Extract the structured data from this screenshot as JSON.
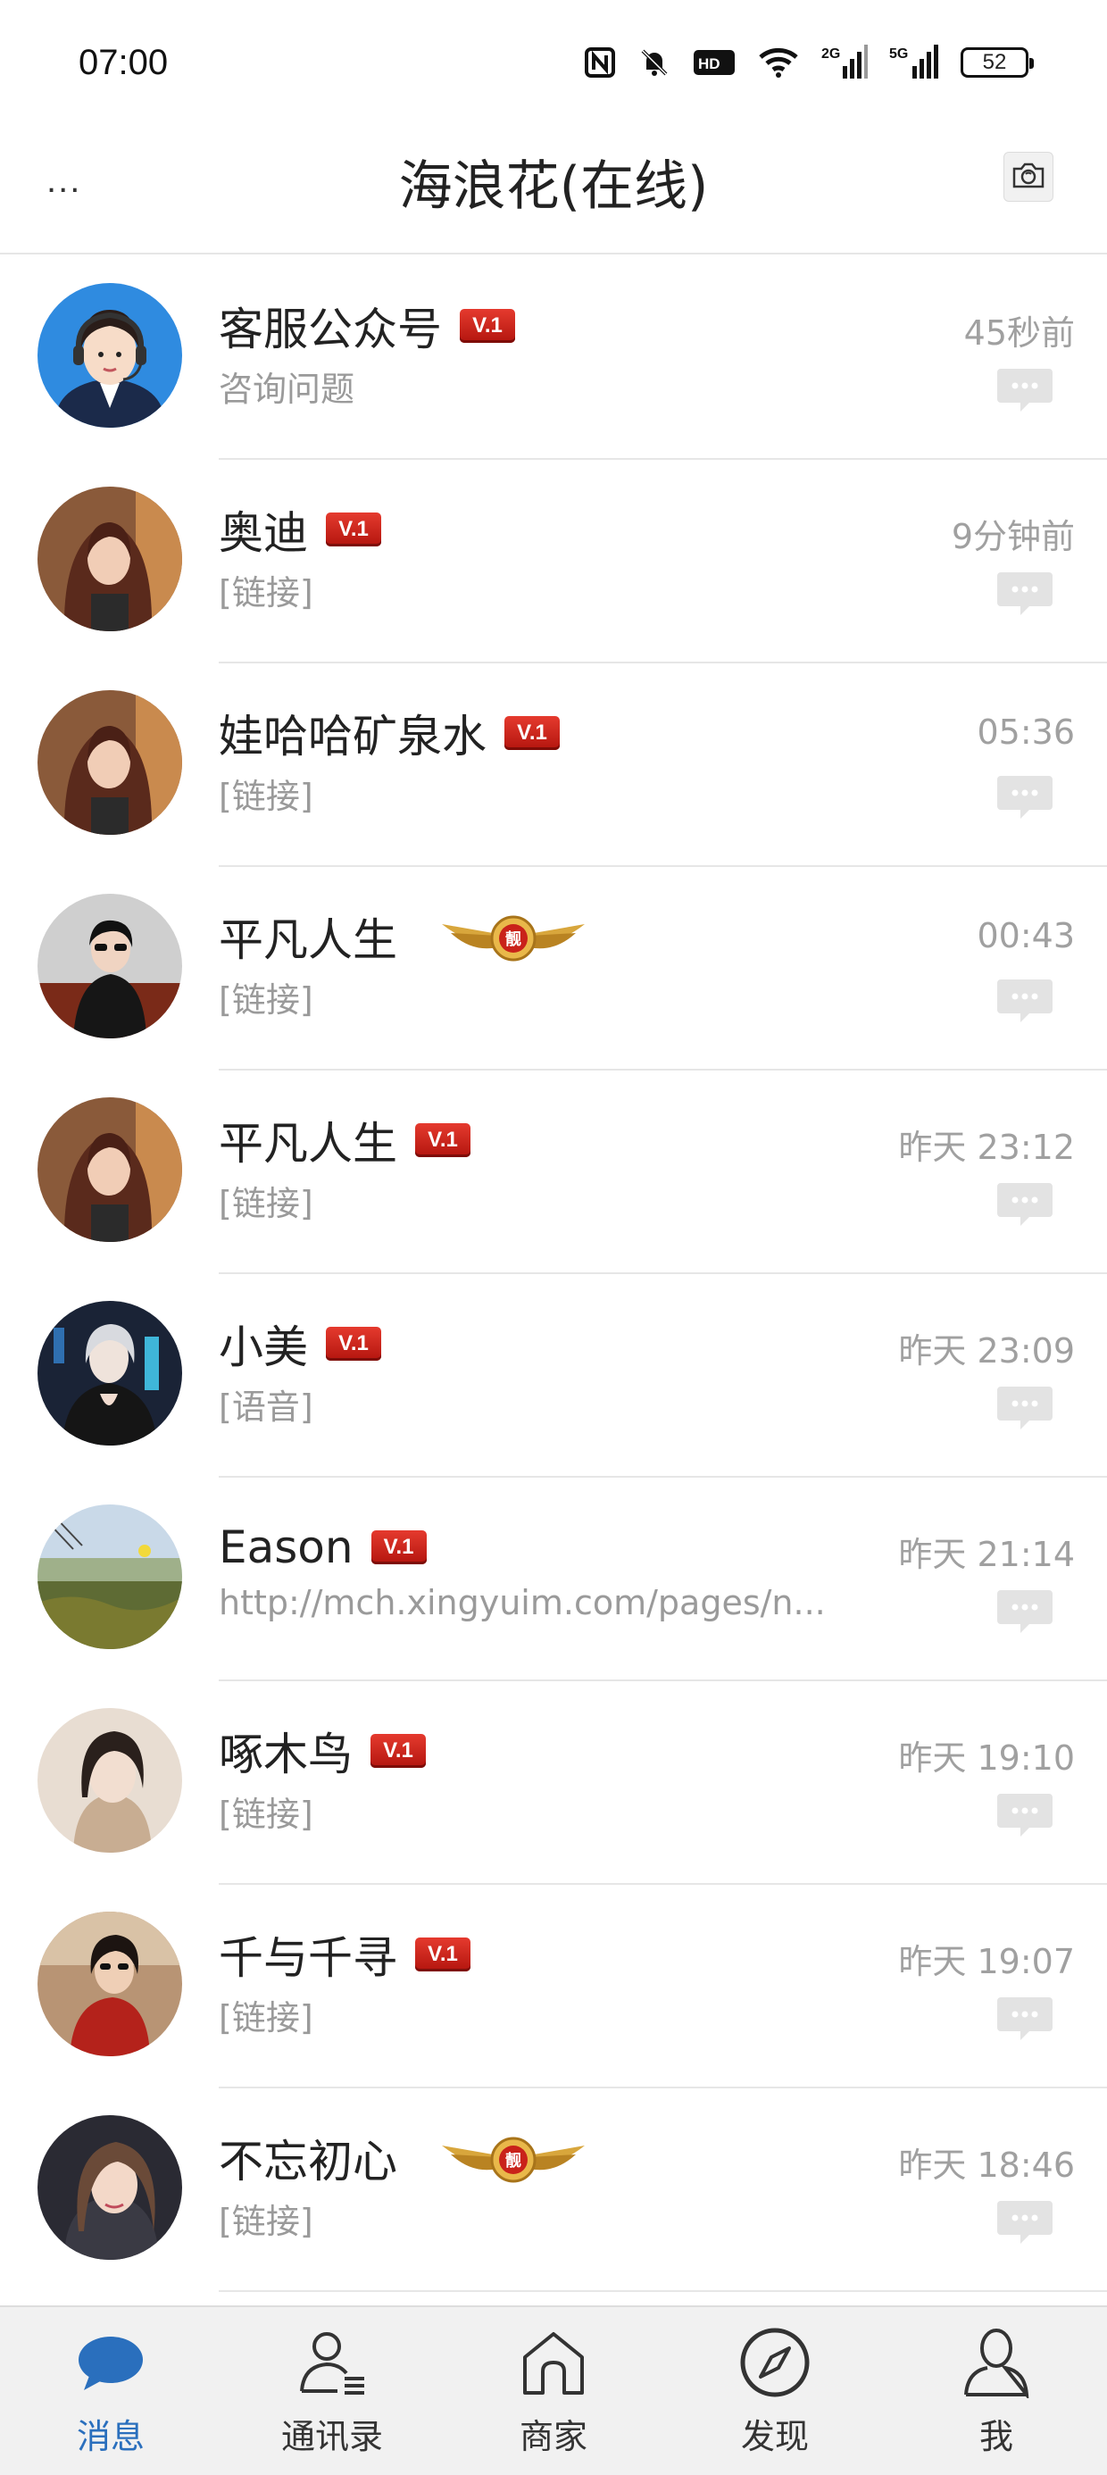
{
  "status_bar": {
    "time": "07:00",
    "battery": "52",
    "net_2g": "2G",
    "net_5g": "5G",
    "hd_label": "HD",
    "icons": [
      "nfc-icon",
      "mute-bell-icon",
      "hd-icon",
      "wifi-icon",
      "signal-2g-icon",
      "signal-5g-icon",
      "battery-icon"
    ]
  },
  "header": {
    "more_label": "...",
    "title": "海浪花(在线)",
    "camera_icon": "camera-icon"
  },
  "badges": {
    "v1": "V.1",
    "crown": "靓"
  },
  "chats": [
    {
      "name": "客服公众号",
      "badge": "v1",
      "preview": "咨询问题",
      "time": "45秒前"
    },
    {
      "name": "奥迪",
      "badge": "v1",
      "preview": "[链接]",
      "time": "9分钟前"
    },
    {
      "name": "娃哈哈矿泉水",
      "badge": "v1",
      "preview": "[链接]",
      "time": "05:36"
    },
    {
      "name": "平凡人生",
      "badge": "crown",
      "preview": "[链接]",
      "time": "00:43"
    },
    {
      "name": "平凡人生",
      "badge": "v1",
      "preview": "[链接]",
      "time": "昨天 23:12"
    },
    {
      "name": "小美",
      "badge": "v1",
      "preview": "[语音]",
      "time": "昨天 23:09"
    },
    {
      "name": "Eason",
      "badge": "v1",
      "preview": "http://mch.xingyuim.com/pages/n...",
      "time": "昨天 21:14"
    },
    {
      "name": "啄木鸟",
      "badge": "v1",
      "preview": "[链接]",
      "time": "昨天 19:10"
    },
    {
      "name": "千与千寻",
      "badge": "v1",
      "preview": "[链接]",
      "time": "昨天 19:07"
    },
    {
      "name": "不忘初心",
      "badge": "crown",
      "preview": "[链接]",
      "time": "昨天 18:46"
    }
  ],
  "tabs": [
    {
      "label": "消息",
      "icon": "chat-bubble-icon",
      "active": true
    },
    {
      "label": "通讯录",
      "icon": "contacts-icon",
      "active": false
    },
    {
      "label": "商家",
      "icon": "store-icon",
      "active": false
    },
    {
      "label": "发现",
      "icon": "compass-icon",
      "active": false
    },
    {
      "label": "我",
      "icon": "profile-icon",
      "active": false
    }
  ],
  "colors": {
    "accent": "#2a6fbd",
    "badge_red": "#d32a1e",
    "muted_text": "#9a9a9a",
    "tab_bar_bg": "#f1f1f1"
  }
}
